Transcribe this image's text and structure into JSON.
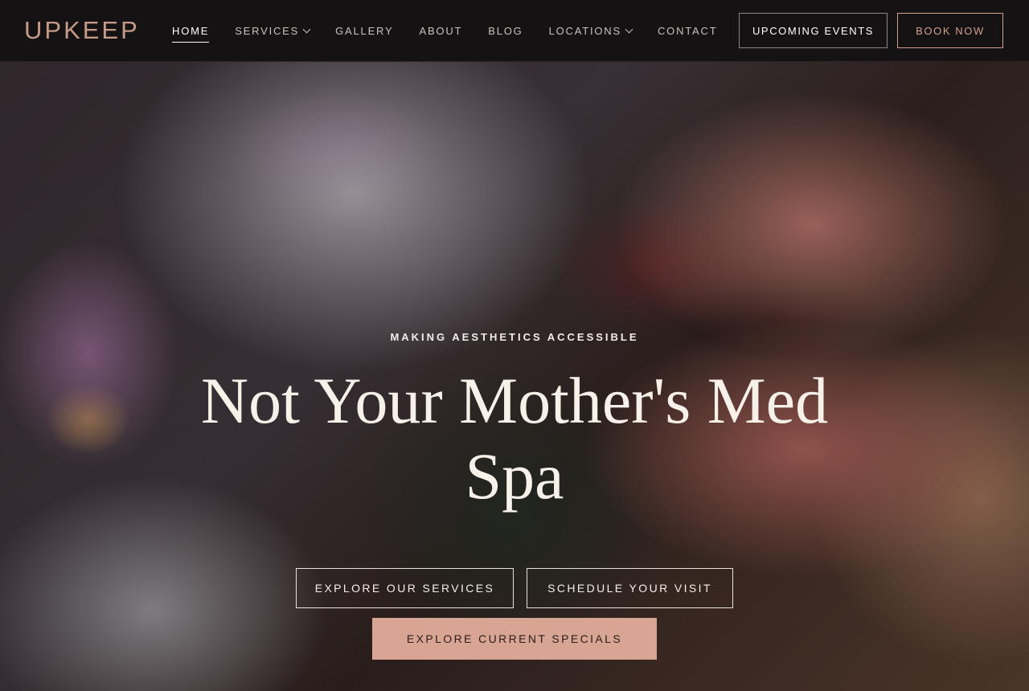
{
  "brand": {
    "logo_text": "UPKEEP",
    "accent_color": "#d4a08f"
  },
  "nav": {
    "items": [
      {
        "label": "HOME",
        "active": true,
        "has_dropdown": false
      },
      {
        "label": "SERVICES",
        "active": false,
        "has_dropdown": true
      },
      {
        "label": "GALLERY",
        "active": false,
        "has_dropdown": false
      },
      {
        "label": "ABOUT",
        "active": false,
        "has_dropdown": false
      },
      {
        "label": "BLOG",
        "active": false,
        "has_dropdown": false
      },
      {
        "label": "LOCATIONS",
        "active": false,
        "has_dropdown": true
      },
      {
        "label": "CONTACT",
        "active": false,
        "has_dropdown": false
      }
    ],
    "upcoming_events_label": "UPCOMING EVENTS",
    "book_now_label": "BOOK NOW"
  },
  "hero": {
    "eyebrow": "MAKING AESTHETICS ACCESSIBLE",
    "headline": "Not Your Mother's Med Spa",
    "buttons": {
      "services": "EXPLORE OUR SERVICES",
      "visit": "SCHEDULE YOUR VISIT",
      "specials": "EXPLORE CURRENT SPECIALS"
    }
  }
}
